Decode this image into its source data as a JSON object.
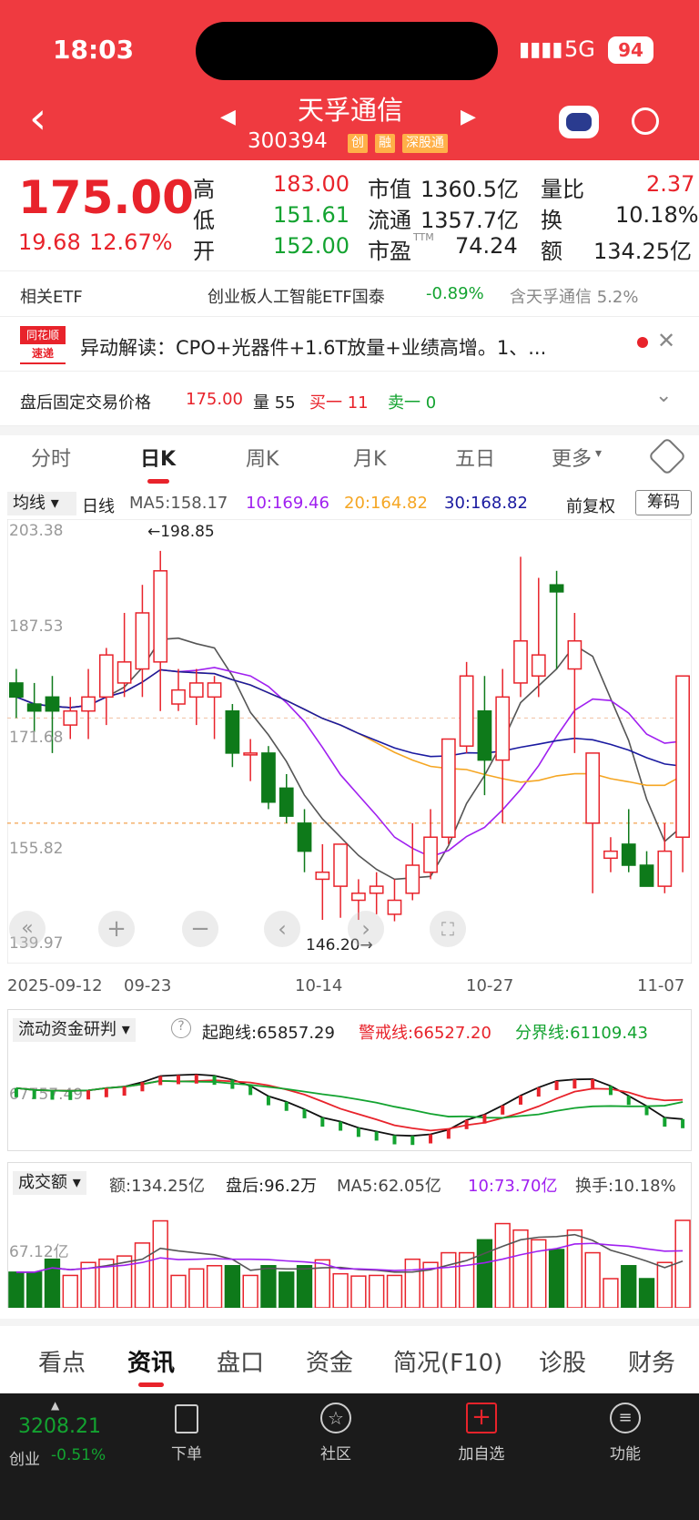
{
  "status": {
    "time": "18:03",
    "network": "5G",
    "battery": "94"
  },
  "header": {
    "title": "天孚通信",
    "code": "300394",
    "tags": [
      "创",
      "融",
      "深股通"
    ]
  },
  "quote": {
    "price": "175.00",
    "change": "19.68",
    "change_pct": "12.67%",
    "high_label": "高",
    "high": "183.00",
    "low_label": "低",
    "low": "151.61",
    "open_label": "开",
    "open": "152.00",
    "mcap_label": "市值",
    "mcap": "1360.5亿",
    "float_label": "流通",
    "float": "1357.7亿",
    "pe_label": "市盈",
    "pe_sup": "TTM",
    "pe": "74.24",
    "vr_label": "量比",
    "vr": "2.37",
    "turn_label": "换",
    "turn": "10.18%",
    "amt_label": "额",
    "amt": "134.25亿"
  },
  "etf": {
    "label": "相关ETF",
    "name": "创业板人工智能ETF国泰",
    "pct": "-0.89%",
    "hold": "含天孚通信 5.2%"
  },
  "news": {
    "logo_top": "同花顺",
    "logo_bottom": "速递",
    "text": "异动解读：CPO+光器件+1.6T放量+业绩高增。1、..."
  },
  "after": {
    "label": "盘后固定交易价格",
    "price": "175.00",
    "vol": "量 55",
    "buy": "买一 11",
    "sell": "卖一 0"
  },
  "tabs": [
    "分时",
    "日K",
    "周K",
    "月K",
    "五日",
    "更多"
  ],
  "ma": {
    "type": "均线",
    "period": "日线",
    "ma5": "MA5:158.17",
    "ma10": "10:169.46",
    "ma20": "20:164.82",
    "ma30": "30:168.82",
    "fq": "前复权",
    "chip": "筹码"
  },
  "axis": {
    "y": [
      "203.38",
      "187.53",
      "171.68",
      "155.82",
      "139.97"
    ],
    "x": [
      "2025-09-12",
      "09-23",
      "10-14",
      "10-27",
      "11-07"
    ],
    "max_ann": "←198.85",
    "min_ann": "146.20→"
  },
  "flow": {
    "name": "流动资金研判",
    "start": "起跑线:65857.29",
    "warn": "警戒线:66527.20",
    "div": "分界线:61109.43",
    "ylbl": "67757.49"
  },
  "vol": {
    "name": "成交额",
    "amt": "额:134.25亿",
    "after": "盘后:96.2万",
    "ma5": "MA5:62.05亿",
    "ma10": "10:73.70亿",
    "turn": "换手:10.18%",
    "ylbl": "67.12亿"
  },
  "bottomtabs": [
    "看点",
    "资讯",
    "盘口",
    "资金",
    "简况(F10)",
    "诊股",
    "财务"
  ],
  "nav": {
    "index": "3208.21",
    "index_name": "创业",
    "index_pct": "-0.51%",
    "items": [
      "下单",
      "社区",
      "加自选",
      "功能"
    ]
  },
  "colors": {
    "up": "#e8232b",
    "down": "#0e7a1a",
    "ma5": "#555555",
    "ma10": "#a020f0",
    "ma20": "#f5a623",
    "ma30": "#1a1aa0"
  },
  "chart_data": {
    "type": "candlestick",
    "ohlc": [
      [
        180,
        182,
        175,
        178
      ],
      [
        177,
        180,
        173,
        176
      ],
      [
        178,
        181,
        170,
        176
      ],
      [
        174,
        178,
        172,
        176
      ],
      [
        176,
        182,
        172,
        178
      ],
      [
        178,
        185,
        174,
        184
      ],
      [
        180,
        190,
        178,
        183
      ],
      [
        182,
        194,
        178,
        190
      ],
      [
        183,
        198.85,
        176,
        196
      ],
      [
        177,
        182,
        176,
        179
      ],
      [
        178,
        182,
        174,
        180
      ],
      [
        178,
        181,
        172,
        180
      ],
      [
        176,
        177,
        168,
        170
      ],
      [
        170,
        172,
        166,
        170
      ],
      [
        170,
        171,
        162,
        163
      ],
      [
        165,
        167,
        160,
        161
      ],
      [
        160,
        162,
        153,
        156
      ],
      [
        152,
        157,
        146.2,
        153
      ],
      [
        151,
        153,
        146.5,
        157
      ],
      [
        149,
        152,
        146.2,
        150
      ],
      [
        150,
        153,
        147,
        151
      ],
      [
        147,
        152,
        146,
        149
      ],
      [
        150,
        160,
        149,
        154
      ],
      [
        153,
        162,
        152,
        158
      ],
      [
        158,
        170,
        157,
        172
      ],
      [
        171,
        183,
        170,
        181
      ],
      [
        176,
        181,
        164,
        169
      ],
      [
        169,
        182,
        160,
        178
      ],
      [
        180,
        198,
        178,
        186
      ],
      [
        181,
        195,
        178,
        184
      ],
      [
        194,
        196,
        182,
        193
      ],
      [
        182,
        190,
        170,
        186
      ],
      [
        160,
        163,
        150,
        170
      ],
      [
        155,
        158,
        153,
        156
      ],
      [
        157,
        162,
        153,
        154
      ],
      [
        154,
        156,
        151,
        151
      ],
      [
        151,
        160,
        150,
        156
      ],
      [
        158,
        176,
        153,
        181
      ]
    ]
  }
}
